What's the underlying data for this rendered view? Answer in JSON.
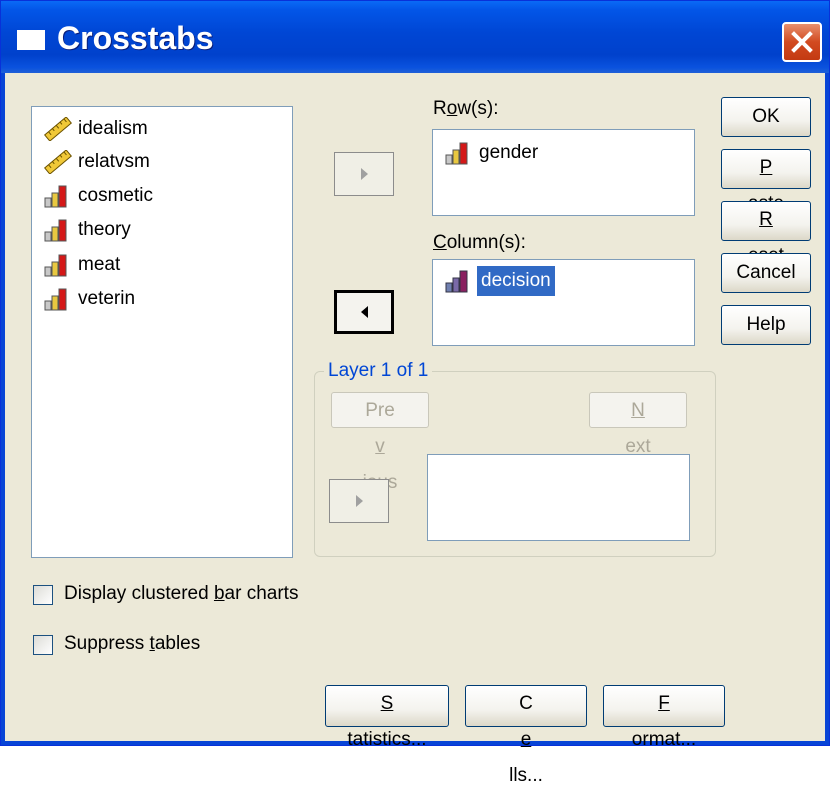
{
  "window": {
    "title": "Crosstabs"
  },
  "variables": [
    {
      "name": "idealism",
      "icon": "ruler-icon"
    },
    {
      "name": "relatvsm",
      "icon": "ruler-icon"
    },
    {
      "name": "cosmetic",
      "icon": "bar-chart-icon"
    },
    {
      "name": "theory",
      "icon": "bar-chart-icon"
    },
    {
      "name": "meat",
      "icon": "bar-chart-icon"
    },
    {
      "name": "veterin",
      "icon": "bar-chart-icon"
    }
  ],
  "rows": {
    "label_prefix": "R",
    "label_underline": "o",
    "label_suffix": "w(s):",
    "items": [
      {
        "name": "gender",
        "icon": "bar-chart-icon"
      }
    ]
  },
  "columns": {
    "label_prefix": "",
    "label_underline": "C",
    "label_suffix": "olumn(s):",
    "items": [
      {
        "name": "decision",
        "icon": "bar-chart-icon",
        "selected": true
      }
    ]
  },
  "layer": {
    "title": "Layer 1 of 1",
    "previous": {
      "prefix": "Pre",
      "underline": "v",
      "suffix": "ious"
    },
    "next": {
      "prefix": "",
      "underline": "N",
      "suffix": "ext"
    }
  },
  "buttons": {
    "ok": "OK",
    "paste": {
      "underline": "P",
      "rest": "aste"
    },
    "reset": {
      "underline": "R",
      "rest": "eset"
    },
    "cancel": "Cancel",
    "help": "Help"
  },
  "options": {
    "clustered": {
      "prefix": "Display clustered ",
      "underline": "b",
      "suffix": "ar charts",
      "checked": false
    },
    "suppress": {
      "prefix": "Suppress ",
      "underline": "t",
      "suffix": "ables",
      "checked": false
    }
  },
  "bottom_buttons": {
    "statistics": {
      "underline": "S",
      "rest": "tatistics..."
    },
    "cells": {
      "prefix": "C",
      "underline": "e",
      "suffix": "lls..."
    },
    "format": {
      "underline": "F",
      "rest": "ormat..."
    }
  },
  "colors": {
    "titlebar": "#0046d4",
    "selection": "#316ac5",
    "group_title": "#0046d5",
    "dialog_bg": "#ece9d8"
  }
}
